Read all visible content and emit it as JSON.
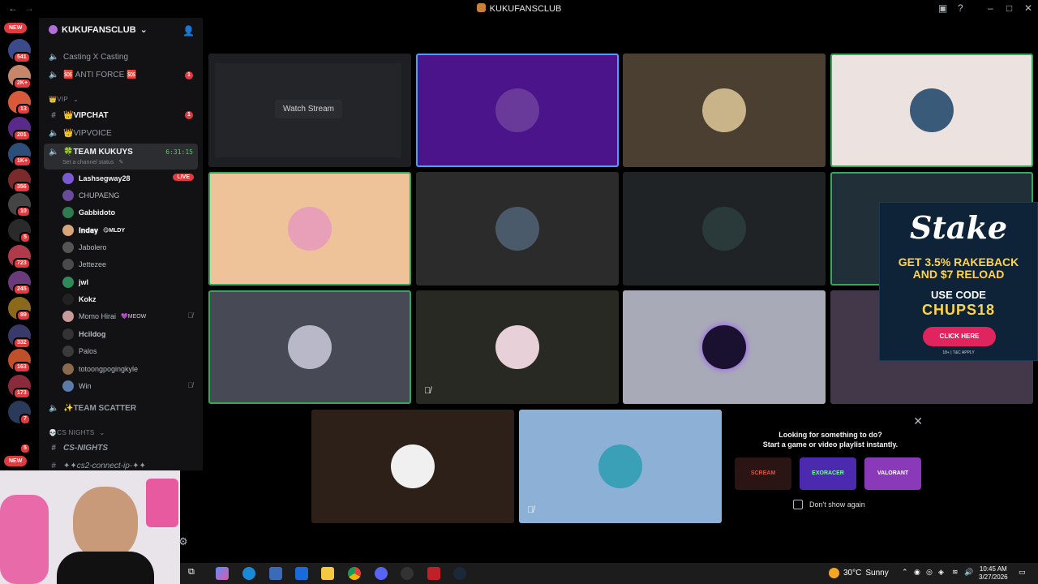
{
  "window": {
    "title": "KUKUFANSCLUB"
  },
  "rail": {
    "badges": [
      "541",
      "2K+",
      "13",
      "201",
      "1K+",
      "356",
      "10",
      "5",
      "723",
      "245",
      "89",
      "332",
      "163",
      "173",
      "7",
      "5"
    ],
    "new_label": "NEW"
  },
  "sidebar": {
    "server_name": "KUKUFANSCLUB",
    "channels": [
      {
        "name": "Casting X Casting"
      },
      {
        "name": "🆘 ANTI FORCE 🆘",
        "unread": "1"
      },
      {
        "name": "👑VIP",
        "category": true
      },
      {
        "name": "👑VIPCHAT",
        "unread": "1"
      },
      {
        "name": "👑VIPVOICE"
      },
      {
        "name": "🍀TEAM KUKUYS",
        "status": "Set a channel status",
        "timer": "6:31:15"
      }
    ],
    "members": [
      {
        "name": "Lashsegway28",
        "live": "LIVE"
      },
      {
        "name": "CHUPAENG"
      },
      {
        "name": "Gabbidoto"
      },
      {
        "name": "𝐈𝐧𝐝𝐚𝐲",
        "tag": "😋MLDY"
      },
      {
        "name": "Jabolero"
      },
      {
        "name": "Jettezee"
      },
      {
        "name": "jwl"
      },
      {
        "name": "Kokz"
      },
      {
        "name": "Momo Hirai",
        "tag": "💜MEOW"
      },
      {
        "name": "𝐇𝐜𝐢𝐥𝐝𝐨𝐠"
      },
      {
        "name": "Palos"
      },
      {
        "name": "totoongpogingkyle"
      },
      {
        "name": "Win"
      }
    ],
    "more": [
      {
        "name": "✨TEAM SCATTER"
      },
      {
        "name": "💀CS NIGHTS",
        "category": true
      },
      {
        "name": "CS-NIGHTS"
      },
      {
        "name": "✦✦cs2-connect-ip-✦✦"
      }
    ]
  },
  "grid": {
    "watch_label": "Watch Stream"
  },
  "ad": {
    "logo": "Stake",
    "line1": "GET 3.5% RAKEBACK",
    "line1b": "AND $7 RELOAD",
    "line2": "USE CODE",
    "code": "CHUPS18",
    "cta": "CLICK HERE",
    "fine": "18+ | T&C APPLY"
  },
  "activity": {
    "line1": "Looking for something to do?",
    "line2": "Start a game or video playlist instantly.",
    "games": [
      "SCREAM",
      "EXORACER",
      "VALORANT"
    ],
    "checkbox": "Don't show again"
  },
  "taskbar": {
    "temp": "30°C",
    "weather": "Sunny",
    "time": "10:45 AM",
    "date": "3/27/2026"
  },
  "colors": {
    "accent_green": "#37a85b",
    "live_red": "#e03b3e",
    "sidebar": "#121214"
  }
}
